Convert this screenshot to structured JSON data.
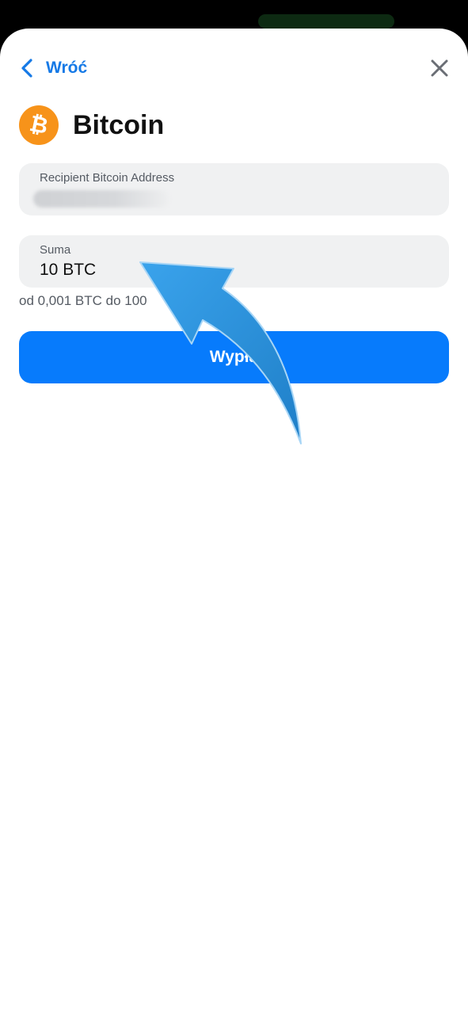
{
  "header": {
    "back_label": "Wróć",
    "back_icon": "chevron-left-icon",
    "close_icon": "close-icon"
  },
  "asset": {
    "title": "Bitcoin",
    "logo_icon": "bitcoin-icon",
    "logo_symbol": "₿",
    "logo_color": "#f7931a"
  },
  "address_field": {
    "label": "Recipient Bitcoin Address",
    "value": ""
  },
  "amount_field": {
    "label": "Suma",
    "value": "10 BTC"
  },
  "limits_hint": "od 0,001 BTC do 100",
  "submit_button": {
    "label": "Wypła"
  },
  "colors": {
    "accent": "#1579e6",
    "button_blue": "#077bfc",
    "field_bg": "#f0f1f2",
    "annotation_arrow": "#2a8fd8"
  },
  "annotation": {
    "arrow_icon": "curved-arrow-icon"
  }
}
